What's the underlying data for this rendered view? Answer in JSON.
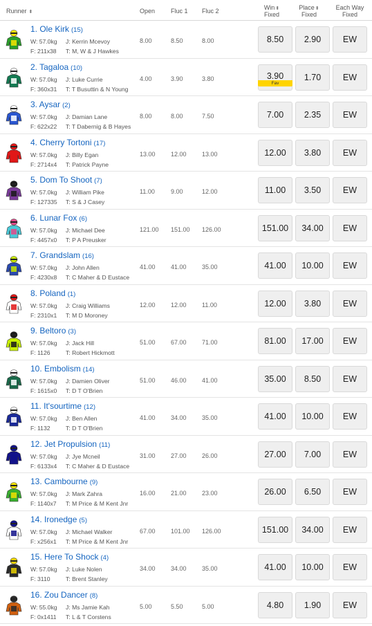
{
  "header": {
    "runner": "Runner",
    "open": "Open",
    "fluc1": "Fluc 1",
    "fluc2": "Fluc 2",
    "win_line1": "Win",
    "win_line2": "Fixed",
    "place_line1": "Place",
    "place_line2": "Fixed",
    "ew_line1": "Each Way",
    "ew_line2": "Fixed"
  },
  "fav_label": "Fav",
  "runners": [
    {
      "name": "1. Ole Kirk",
      "barrier": "(15)",
      "weight": "W: 57.0kg",
      "jockey": "J: Kerrin Mcevoy",
      "form": "F: 211x38",
      "trainer": "T: M, W & J Hawkes",
      "open": "8.00",
      "fluc1": "8.50",
      "fluc2": "8.00",
      "win": "8.50",
      "place": "2.90",
      "ew": "EW",
      "silk": [
        "#2aa02a",
        "#f5e400"
      ]
    },
    {
      "name": "2. Tagaloa",
      "barrier": "(10)",
      "weight": "W: 57.0kg",
      "jockey": "J: Luke Currie",
      "form": "F: 360x31",
      "trainer": "T: T Busuttin & N Young",
      "open": "4.00",
      "fluc1": "3.90",
      "fluc2": "3.80",
      "win": "3.90",
      "place": "1.70",
      "ew": "EW",
      "silk": [
        "#137a52",
        "#ffffff"
      ]
    },
    {
      "name": "3. Aysar",
      "barrier": "(2)",
      "weight": "W: 57.0kg",
      "jockey": "J: Damian Lane",
      "form": "F: 622x22",
      "trainer": "T: T Dabernig & B Hayes",
      "open": "8.00",
      "fluc1": "8.00",
      "fluc2": "7.50",
      "win": "7.00",
      "place": "2.35",
      "ew": "EW",
      "silk": [
        "#2a56d0",
        "#ffffff"
      ]
    },
    {
      "name": "4. Cherry Tortoni",
      "barrier": "(17)",
      "weight": "W: 57.0kg",
      "jockey": "J: Billy Egan",
      "form": "F: 2714x4",
      "trainer": "T: Patrick Payne",
      "open": "13.00",
      "fluc1": "12.00",
      "fluc2": "13.00",
      "win": "12.00",
      "place": "3.80",
      "ew": "EW",
      "silk": [
        "#e01818",
        "#e01818"
      ]
    },
    {
      "name": "5. Dom To Shoot",
      "barrier": "(7)",
      "weight": "W: 57.0kg",
      "jockey": "J: William Pike",
      "form": "F: 127335",
      "trainer": "T: S & J Casey",
      "open": "11.00",
      "fluc1": "9.00",
      "fluc2": "12.00",
      "win": "11.00",
      "place": "3.50",
      "ew": "EW",
      "silk": [
        "#7a3a9a",
        "#1a1a1a"
      ]
    },
    {
      "name": "6. Lunar Fox",
      "barrier": "(6)",
      "weight": "W: 57.0kg",
      "jockey": "J: Michael Dee",
      "form": "F: 4457x0",
      "trainer": "T: P A Preusker",
      "open": "121.00",
      "fluc1": "151.00",
      "fluc2": "126.00",
      "win": "151.00",
      "place": "34.00",
      "ew": "EW",
      "silk": [
        "#49c9d8",
        "#e04a8a"
      ]
    },
    {
      "name": "7. Grandslam",
      "barrier": "(16)",
      "weight": "W: 57.0kg",
      "jockey": "J: John Allen",
      "form": "F: 4230x8",
      "trainer": "T: C Maher & D Eustace",
      "open": "41.00",
      "fluc1": "41.00",
      "fluc2": "35.00",
      "win": "41.00",
      "place": "10.00",
      "ew": "EW",
      "silk": [
        "#2a4ab0",
        "#c8e800"
      ]
    },
    {
      "name": "8. Poland",
      "barrier": "(1)",
      "weight": "W: 57.0kg",
      "jockey": "J: Craig Williams",
      "form": "F: 2310x1",
      "trainer": "T: M D Moroney",
      "open": "12.00",
      "fluc1": "12.00",
      "fluc2": "11.00",
      "win": "12.00",
      "place": "3.80",
      "ew": "EW",
      "silk": [
        "#ffffff",
        "#e01818"
      ]
    },
    {
      "name": "9. Beltoro",
      "barrier": "(3)",
      "weight": "W: 57.0kg",
      "jockey": "J: Jack Hill",
      "form": "F: 1126",
      "trainer": "T: Robert Hickmott",
      "open": "51.00",
      "fluc1": "67.00",
      "fluc2": "71.00",
      "win": "81.00",
      "place": "17.00",
      "ew": "EW",
      "silk": [
        "#c8f000",
        "#1a1a1a"
      ]
    },
    {
      "name": "10. Embolism",
      "barrier": "(14)",
      "weight": "W: 57.0kg",
      "jockey": "J: Damien Oliver",
      "form": "F: 1615x0",
      "trainer": "T: D T O'Brien",
      "open": "51.00",
      "fluc1": "46.00",
      "fluc2": "41.00",
      "win": "35.00",
      "place": "8.50",
      "ew": "EW",
      "silk": [
        "#1a6a4a",
        "#ffffff"
      ]
    },
    {
      "name": "11. It'sourtime",
      "barrier": "(12)",
      "weight": "W: 57.0kg",
      "jockey": "J: Ben Allen",
      "form": "F: 1132",
      "trainer": "T: D T O'Brien",
      "open": "41.00",
      "fluc1": "34.00",
      "fluc2": "35.00",
      "win": "41.00",
      "place": "10.00",
      "ew": "EW",
      "silk": [
        "#1a2a9a",
        "#ffffff"
      ]
    },
    {
      "name": "12. Jet Propulsion",
      "barrier": "(11)",
      "weight": "W: 57.0kg",
      "jockey": "J: Jye Mcneil",
      "form": "F: 6133x4",
      "trainer": "T: C Maher & D Eustace",
      "open": "31.00",
      "fluc1": "27.00",
      "fluc2": "26.00",
      "win": "27.00",
      "place": "7.00",
      "ew": "EW",
      "silk": [
        "#12128a",
        "#12128a"
      ]
    },
    {
      "name": "13. Cambourne",
      "barrier": "(9)",
      "weight": "W: 57.0kg",
      "jockey": "J: Mark Zahra",
      "form": "F: 1140x7",
      "trainer": "T: M Price & M Kent Jnr",
      "open": "16.00",
      "fluc1": "21.00",
      "fluc2": "23.00",
      "win": "26.00",
      "place": "6.50",
      "ew": "EW",
      "silk": [
        "#3ab030",
        "#f0e000"
      ]
    },
    {
      "name": "14. Ironedge",
      "barrier": "(5)",
      "weight": "W: 57.0kg",
      "jockey": "J: Michael Walker",
      "form": "F: x256x1",
      "trainer": "T: M Price & M Kent Jnr",
      "open": "67.00",
      "fluc1": "101.00",
      "fluc2": "126.00",
      "win": "151.00",
      "place": "34.00",
      "ew": "EW",
      "silk": [
        "#ffffff",
        "#12128a"
      ]
    },
    {
      "name": "15. Here To Shock",
      "barrier": "(4)",
      "weight": "W: 57.0kg",
      "jockey": "J: Luke Nolen",
      "form": "F: 3110",
      "trainer": "T: Brent Stanley",
      "open": "34.00",
      "fluc1": "34.00",
      "fluc2": "35.00",
      "win": "41.00",
      "place": "10.00",
      "ew": "EW",
      "silk": [
        "#2a2a2a",
        "#e8d000"
      ]
    },
    {
      "name": "16. Zou Dancer",
      "barrier": "(8)",
      "weight": "W: 55.0kg",
      "jockey": "J: Ms Jamie Kah",
      "form": "F: 0x1411",
      "trainer": "T: L & T Corstens",
      "open": "5.00",
      "fluc1": "5.50",
      "fluc2": "5.00",
      "win": "4.80",
      "place": "1.90",
      "ew": "EW",
      "silk": [
        "#d06010",
        "#2a2a2a"
      ]
    }
  ]
}
